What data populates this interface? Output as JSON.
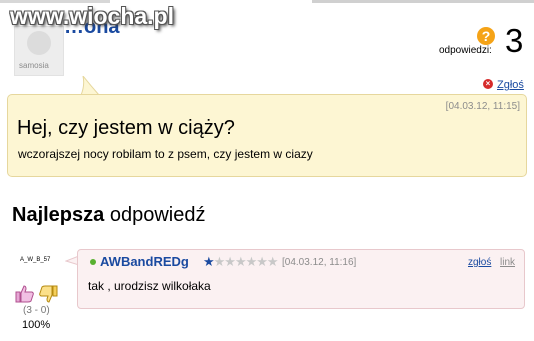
{
  "watermark": "www.wiocha.pl",
  "avatar_brand": "samosia",
  "question": {
    "title_visible": "…ona",
    "badge": "?",
    "answers_label": "odpowiedzi:",
    "answers_count": "3",
    "report_label": "Zgłoś",
    "date": "[04.03.12, 11:15]",
    "heading": "Hej, czy jestem w ciąży?",
    "body": "wczorajszej nocy robilam to z psem, czy jestem w ciazy"
  },
  "best_answer": {
    "heading_bold": "Najlepsza",
    "heading_rest": " odpowiedź",
    "avatar_text": "A_W_B_57",
    "user": "AWBandREDg",
    "stars": "★★★★★★★",
    "date": "[04.03.12, 11:16]",
    "report_label": "zgłoś",
    "link_label": "link",
    "body": "tak , urodzisz wilkołaka",
    "votes": "(3 - 0)",
    "percent": "100%"
  },
  "colors": {
    "link_blue": "#1a4aa0",
    "question_bg": "#fdf6d3",
    "answer_bg": "#fbf1f2",
    "badge_orange": "#f5a317"
  }
}
